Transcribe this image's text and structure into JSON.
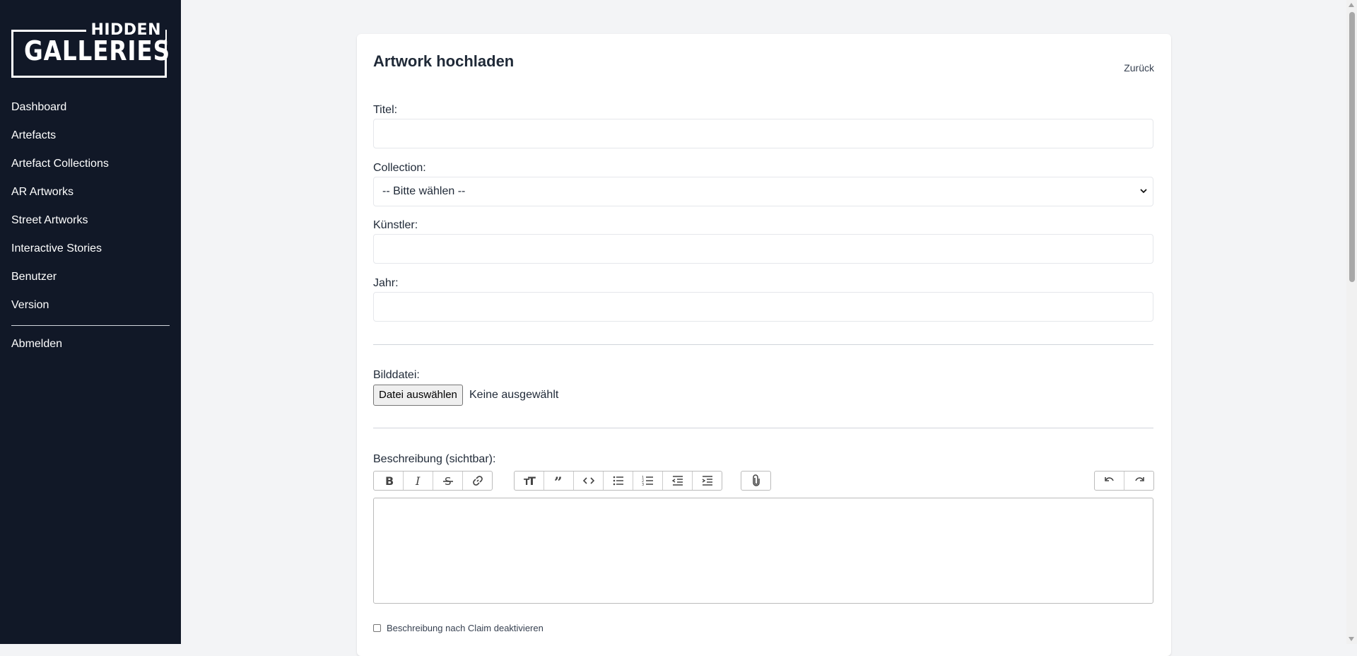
{
  "logo": {
    "top": "HIDDEN",
    "bottom": "GALLERIES"
  },
  "sidebar": {
    "items": [
      {
        "label": "Dashboard"
      },
      {
        "label": "Artefacts"
      },
      {
        "label": "Artefact Collections"
      },
      {
        "label": "AR Artworks"
      },
      {
        "label": "Street Artworks"
      },
      {
        "label": "Interactive Stories"
      },
      {
        "label": "Benutzer"
      },
      {
        "label": "Version"
      }
    ],
    "logout": "Abmelden"
  },
  "page": {
    "title": "Artwork hochladen",
    "back": "Zurück"
  },
  "form": {
    "title_label": "Titel:",
    "title_value": "",
    "collection_label": "Collection:",
    "collection_selected": "-- Bitte wählen --",
    "artist_label": "Künstler:",
    "artist_value": "",
    "year_label": "Jahr:",
    "year_value": "",
    "image_label": "Bilddatei:",
    "file_button": "Datei auswählen",
    "file_status": "Keine ausgewählt",
    "description_label": "Beschreibung (sichtbar):",
    "description_value": "",
    "disable_checkbox_label": "Beschreibung nach Claim deaktivieren",
    "disable_checkbox_checked": false
  },
  "toolbar": {
    "icons": [
      "bold-icon",
      "italic-icon",
      "strikethrough-icon",
      "link-icon",
      "heading-icon",
      "quote-icon",
      "code-icon",
      "bullet-list-icon",
      "numbered-list-icon",
      "decrease-indent-icon",
      "increase-indent-icon",
      "attach-file-icon",
      "undo-icon",
      "redo-icon"
    ]
  }
}
